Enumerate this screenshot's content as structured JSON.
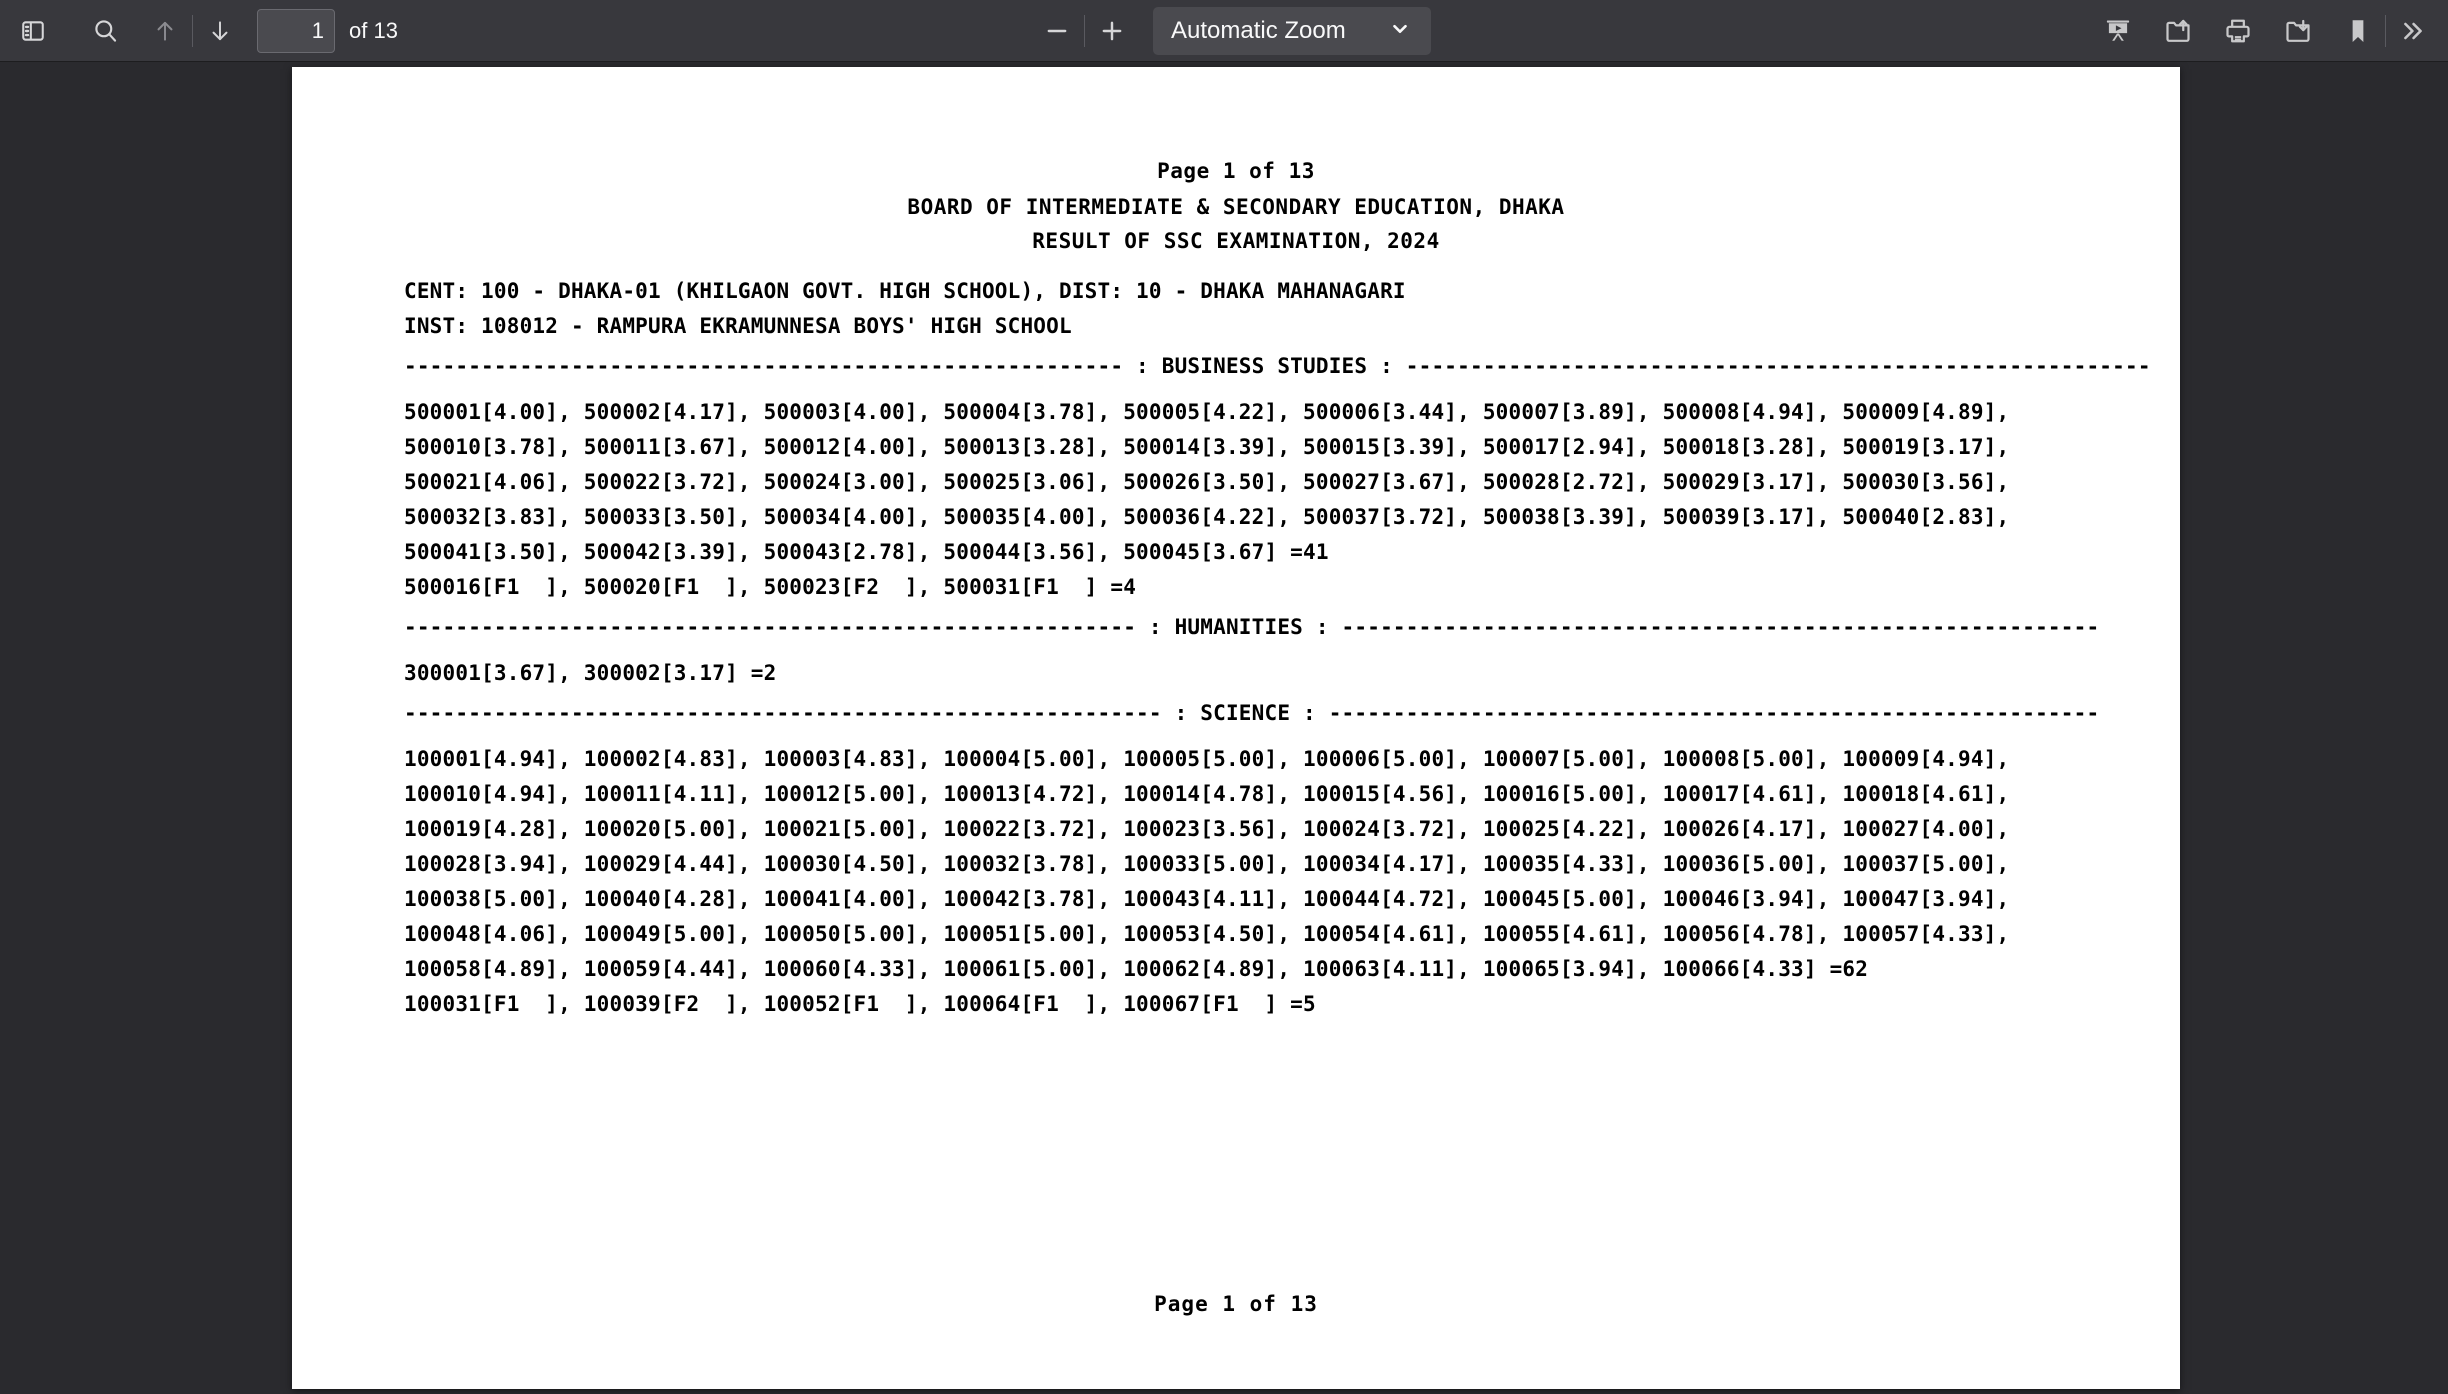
{
  "toolbar": {
    "sidebar_toggle_icon": "sidebar-toggle-icon",
    "search_icon": "search-icon",
    "prev_page_icon": "arrow-up-icon",
    "next_page_icon": "arrow-down-icon",
    "page_number_value": "1",
    "page_count_label": "of 13",
    "zoom_out_icon": "minus-icon",
    "zoom_in_icon": "plus-icon",
    "zoom_level": "Automatic Zoom",
    "zoom_chevron_icon": "chevron-down-icon",
    "presentation_icon": "presentation-mode-icon",
    "open_file_icon": "open-file-icon",
    "print_icon": "print-icon",
    "save_icon": "save-file-icon",
    "bookmark_icon": "bookmark-icon",
    "more_tools_icon": "double-chevron-right-icon"
  },
  "document": {
    "header": {
      "page_indicator": "Page 1 of 13",
      "board_line": "BOARD OF INTERMEDIATE & SECONDARY EDUCATION, DHAKA",
      "result_line": "RESULT OF SSC EXAMINATION, 2024"
    },
    "meta": [
      "CENT: 100 - DHAKA-01 (KHILGAON GOVT. HIGH SCHOOL), DIST: 10 - DHAKA MAHANAGARI",
      "INST: 108012 - RAMPURA EKRAMUNNESA BOYS' HIGH SCHOOL"
    ],
    "sections": [
      {
        "name": "BUSINESS STUDIES",
        "rule": "-------------------------------------------------------- : BUSINESS STUDIES : ----------------------------------------------------------",
        "lines": [
          "500001[4.00], 500002[4.17], 500003[4.00], 500004[3.78], 500005[4.22], 500006[3.44], 500007[3.89], 500008[4.94], 500009[4.89],",
          "500010[3.78], 500011[3.67], 500012[4.00], 500013[3.28], 500014[3.39], 500015[3.39], 500017[2.94], 500018[3.28], 500019[3.17],",
          "500021[4.06], 500022[3.72], 500024[3.00], 500025[3.06], 500026[3.50], 500027[3.67], 500028[2.72], 500029[3.17], 500030[3.56],",
          "500032[3.83], 500033[3.50], 500034[4.00], 500035[4.00], 500036[4.22], 500037[3.72], 500038[3.39], 500039[3.17], 500040[2.83],",
          "500041[3.50], 500042[3.39], 500043[2.78], 500044[3.56], 500045[3.67] =41",
          "500016[F1  ], 500020[F1  ], 500023[F2  ], 500031[F1  ] =4"
        ],
        "pass_count": "41",
        "fail_count": "4"
      },
      {
        "name": "HUMANITIES",
        "rule": "--------------------------------------------------------- : HUMANITIES : -----------------------------------------------------------",
        "lines": [
          "300001[3.67], 300002[3.17] =2"
        ],
        "pass_count": "2",
        "fail_count": ""
      },
      {
        "name": "SCIENCE",
        "rule": "----------------------------------------------------------- : SCIENCE : ------------------------------------------------------------",
        "lines": [
          "100001[4.94], 100002[4.83], 100003[4.83], 100004[5.00], 100005[5.00], 100006[5.00], 100007[5.00], 100008[5.00], 100009[4.94],",
          "100010[4.94], 100011[4.11], 100012[5.00], 100013[4.72], 100014[4.78], 100015[4.56], 100016[5.00], 100017[4.61], 100018[4.61],",
          "100019[4.28], 100020[5.00], 100021[5.00], 100022[3.72], 100023[3.56], 100024[3.72], 100025[4.22], 100026[4.17], 100027[4.00],",
          "100028[3.94], 100029[4.44], 100030[4.50], 100032[3.78], 100033[5.00], 100034[4.17], 100035[4.33], 100036[5.00], 100037[5.00],",
          "100038[5.00], 100040[4.28], 100041[4.00], 100042[3.78], 100043[4.11], 100044[4.72], 100045[5.00], 100046[3.94], 100047[3.94],",
          "100048[4.06], 100049[5.00], 100050[5.00], 100051[5.00], 100053[4.50], 100054[4.61], 100055[4.61], 100056[4.78], 100057[4.33],",
          "100058[4.89], 100059[4.44], 100060[4.33], 100061[5.00], 100062[4.89], 100063[4.11], 100065[3.94], 100066[4.33] =62",
          "100031[F1  ], 100039[F2  ], 100052[F1  ], 100064[F1  ], 100067[F1  ] =5"
        ],
        "pass_count": "62",
        "fail_count": "5"
      }
    ],
    "footer": "Page 1 of 13"
  },
  "colors": {
    "toolbar_bg": "#38383d",
    "viewer_bg": "#2a2a2e",
    "page_bg": "#ffffff",
    "text": "#f9f9fa",
    "doc_text": "#000000",
    "field_bg": "#4a4a4f"
  }
}
